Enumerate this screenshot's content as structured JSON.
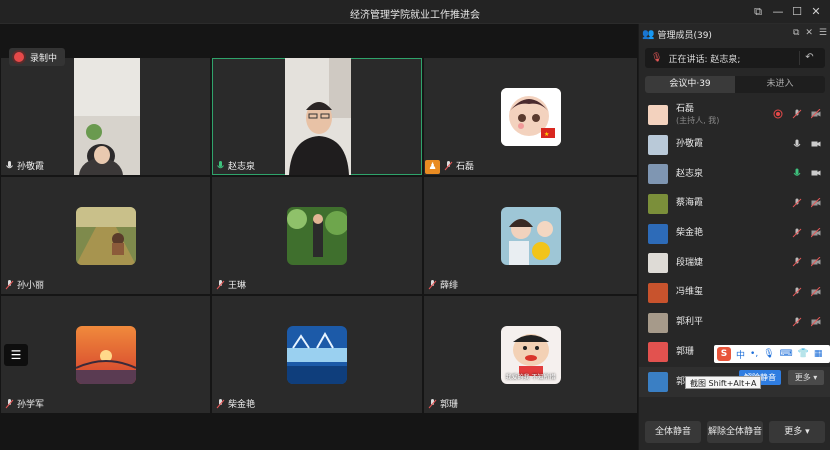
{
  "window": {
    "title": "经济管理学院就业工作推进会"
  },
  "recording": {
    "label": "录制中"
  },
  "grid": {
    "tiles": [
      {
        "name": "孙敬霞"
      },
      {
        "name": "赵志泉"
      },
      {
        "name": "石磊"
      },
      {
        "name": "孙小丽"
      },
      {
        "name": "王琳"
      },
      {
        "name": "薛绯"
      },
      {
        "name": "孙学军"
      },
      {
        "name": "柴金艳"
      },
      {
        "name": "郭珊"
      }
    ],
    "tile_caption": "我爱的我 不知所措"
  },
  "panel": {
    "title": "管理成员(39)",
    "speaking": "正在讲话: 赵志泉;",
    "tabs": [
      {
        "label": "会议中·39"
      },
      {
        "label": "未进入"
      }
    ],
    "members": [
      {
        "name": "石磊",
        "sub": "(主持人, 我)"
      },
      {
        "name": "孙敬霞"
      },
      {
        "name": "赵志泉"
      },
      {
        "name": "蔡海霞"
      },
      {
        "name": "柴金艳"
      },
      {
        "name": "段瑞婕"
      },
      {
        "name": "冯维玺"
      },
      {
        "name": "郭利平"
      },
      {
        "name": "郭珊"
      },
      {
        "name": "郭正龙"
      }
    ],
    "footer": {
      "mute_all": "全体静音",
      "unmute_all": "解除全体静音",
      "more": "更多 ▾"
    },
    "row_popup": {
      "unmute": "解除静音",
      "more": "更多 ▾"
    }
  },
  "ime": {
    "lang": "中"
  },
  "tooltip": {
    "text": "截图 Shift+Alt+A"
  },
  "colors": {
    "accent": "#2f7de1",
    "speaking_green": "#2fa36b",
    "rec_red": "#e64949",
    "host_orange": "#e98b22"
  }
}
